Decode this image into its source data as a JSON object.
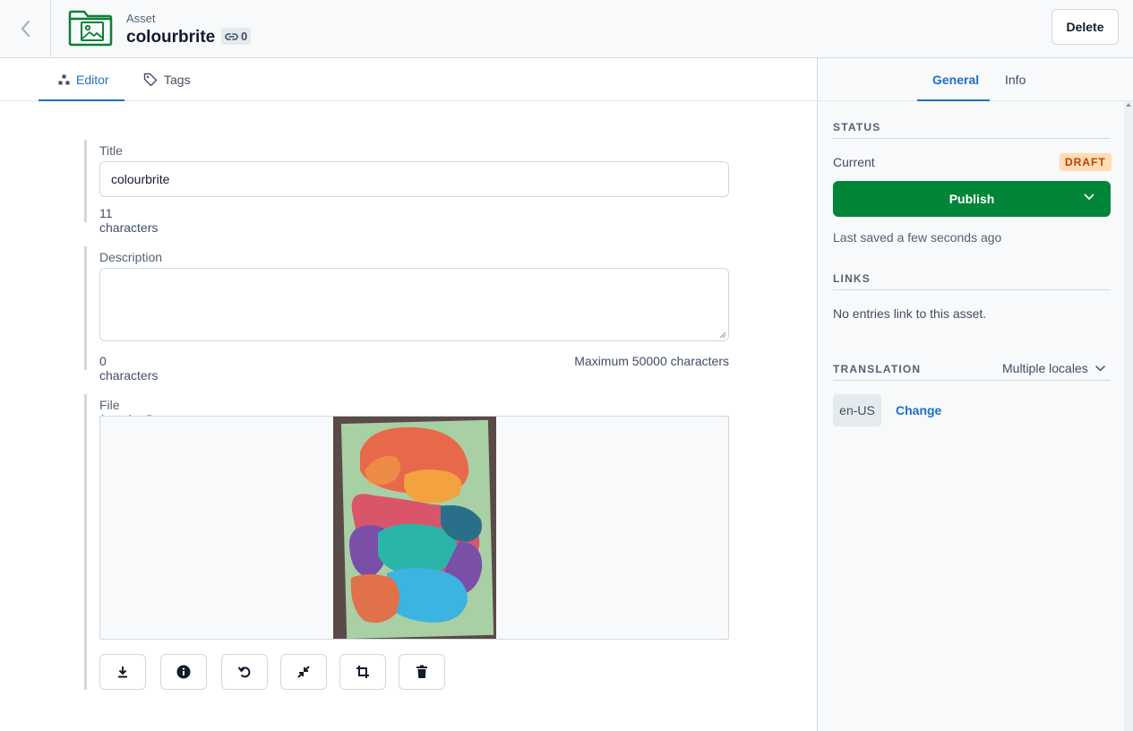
{
  "header": {
    "entity_type": "Asset",
    "title": "colourbrite",
    "references_count": "0",
    "delete_label": "Delete"
  },
  "editor": {
    "tabs": [
      {
        "label": "Editor",
        "active": true
      },
      {
        "label": "Tags",
        "active": false
      }
    ],
    "title_field": {
      "label": "Title",
      "value": "colourbrite",
      "char_count": "11 characters"
    },
    "description_field": {
      "label": "Description",
      "value": "",
      "char_count": "0 characters",
      "max_chars": "Maximum 50000 characters"
    },
    "file_field": {
      "label": "File (required)",
      "toolbar": [
        "download-icon",
        "info-icon",
        "rotate-icon",
        "shrink-icon",
        "crop-icon",
        "trash-icon"
      ]
    }
  },
  "sidebar": {
    "tabs": [
      {
        "label": "General",
        "active": true
      },
      {
        "label": "Info",
        "active": false
      }
    ],
    "status": {
      "title": "STATUS",
      "current_label": "Current",
      "badge": "DRAFT",
      "publish_label": "Publish",
      "last_saved": "Last saved a few seconds ago"
    },
    "links": {
      "title": "LINKS",
      "text": "No entries link to this asset."
    },
    "translation": {
      "title": "TRANSLATION",
      "mode": "Multiple locales",
      "locale": "en-US",
      "change_label": "Change"
    }
  },
  "colors": {
    "accent": "#1f6fc7",
    "publish": "#008539",
    "draft_bg": "#ffdcb3",
    "draft_text": "#bf3d00",
    "asset_icon": "#0d7f35"
  }
}
